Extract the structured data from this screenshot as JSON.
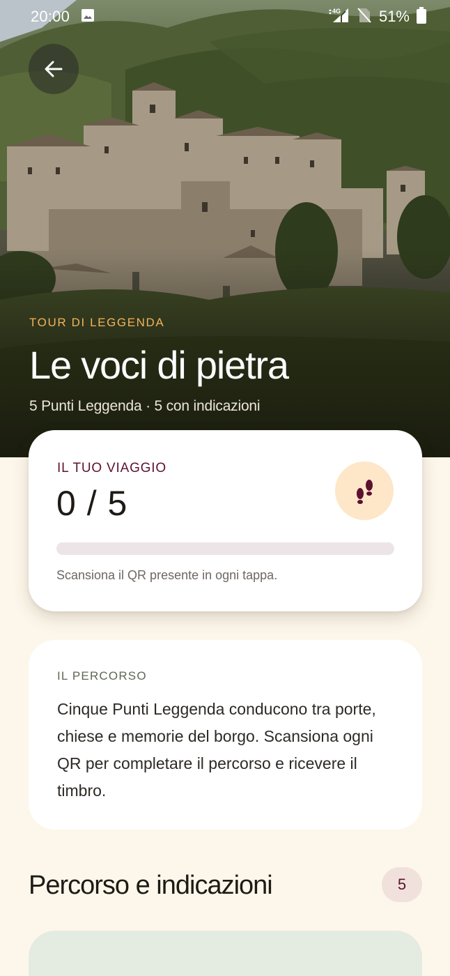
{
  "status_bar": {
    "time": "20:00",
    "battery": "51%",
    "network": "4G",
    "icons": [
      "image-icon",
      "signal-icon",
      "no-sim-icon",
      "battery-icon"
    ]
  },
  "header": {
    "back_icon": "arrow-left-icon",
    "eyebrow": "TOUR DI LEGGENDA",
    "title": "Le voci di pietra",
    "subtitle": "5 Punti Leggenda · 5 con indicazioni"
  },
  "journey": {
    "label": "IL TUO VIAGGIO",
    "count_text": "0 / 5",
    "completed": 0,
    "total": 5,
    "icon": "footprints-icon",
    "hint": "Scansiona il QR presente in ogni tappa."
  },
  "route": {
    "label": "IL PERCORSO",
    "description": "Cinque Punti Leggenda conducono tra porte, chiese e memorie del borgo. Scansiona ogni QR per completare il percorso e ricevere il timbro."
  },
  "section": {
    "title": "Percorso e indicazioni",
    "count": "5"
  },
  "colors": {
    "accent": "#5c1130",
    "eyebrow": "#f2b35c",
    "background": "#fdf7eb",
    "badge_bg": "#fde7c8",
    "next_card": "#e4ebe1"
  }
}
